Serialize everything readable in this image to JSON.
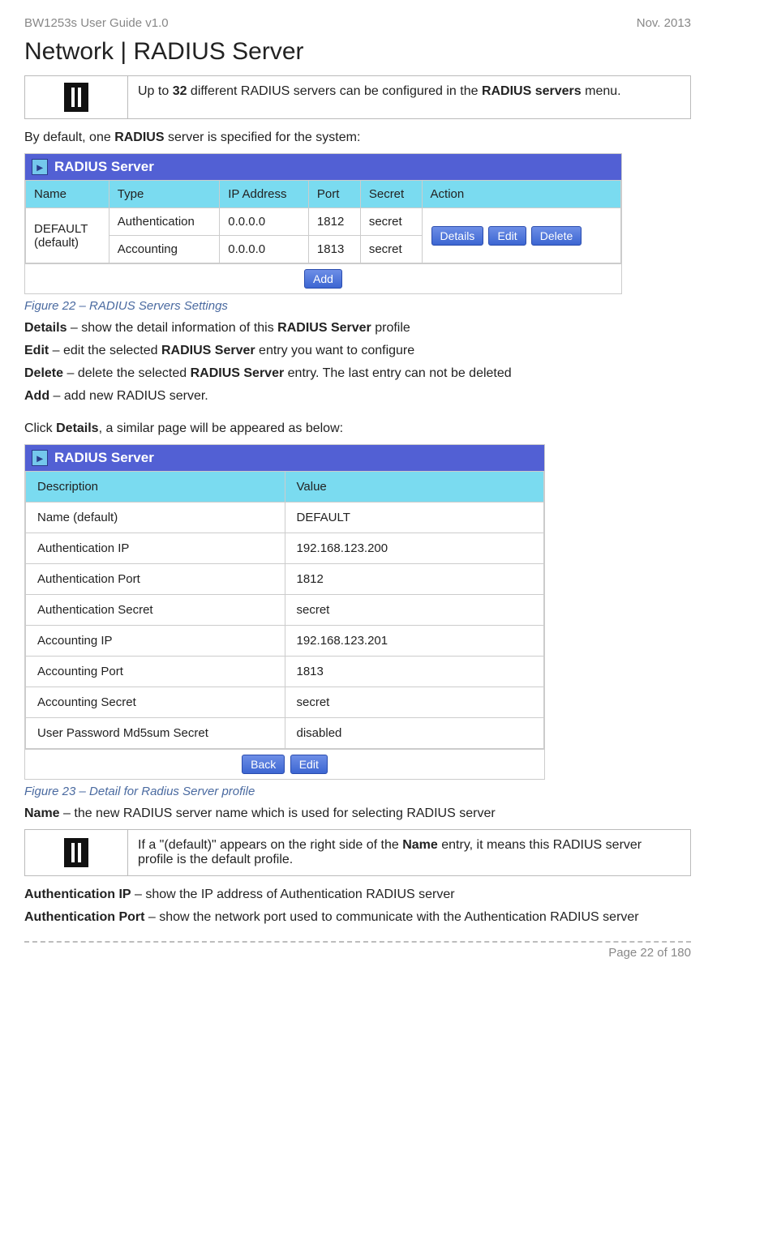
{
  "header": {
    "left": "BW1253s User Guide v1.0",
    "right": "Nov.  2013"
  },
  "titleLine": "Network | RADIUS Server",
  "infobox1": "Up to <b>32</b> different RADIUS servers can be configured in the <b>RADIUS servers</b> menu.",
  "intro1_before": "By default, one ",
  "intro1_bold": "RADIUS",
  "intro1_after": " server is specified for the system:",
  "table1": {
    "title": "RADIUS Server",
    "headers": [
      "Name",
      "Type",
      "IP Address",
      "Port",
      "Secret",
      "Action"
    ],
    "nameCell": "DEFAULT\n(default)",
    "rows": [
      {
        "type": "Authentication",
        "ip": "0.0.0.0",
        "port": "1812",
        "secret": "secret"
      },
      {
        "type": "Accounting",
        "ip": "0.0.0.0",
        "port": "1813",
        "secret": "secret"
      }
    ],
    "actionButtons": [
      "Details",
      "Edit",
      "Delete"
    ],
    "addLabel": "Add"
  },
  "fig22": "Figure 22 – RADIUS Servers Settings",
  "defs": [
    {
      "term": "Details",
      "desc_before": " – show the detail information of this ",
      "desc_bold": "RADIUS Server",
      "desc_after": " profile"
    },
    {
      "term": "Edit",
      "desc_before": " – edit the selected ",
      "desc_bold": "RADIUS Server",
      "desc_after": " entry you want to configure"
    },
    {
      "term": "Delete",
      "desc_before": " – delete the selected ",
      "desc_bold": "RADIUS Server",
      "desc_after": " entry. The last entry can not be deleted"
    },
    {
      "term": "Add",
      "desc_before": " – add new RADIUS server.",
      "desc_bold": "",
      "desc_after": ""
    }
  ],
  "intro2_before": "Click ",
  "intro2_bold": "Details",
  "intro2_after": ", a similar page will be appeared as below:",
  "table2": {
    "title": "RADIUS Server",
    "headers": [
      "Description",
      "Value"
    ],
    "rows": [
      [
        "Name  (default)",
        "DEFAULT"
      ],
      [
        "Authentication IP",
        "192.168.123.200"
      ],
      [
        "Authentication Port",
        "1812"
      ],
      [
        "Authentication Secret",
        "secret"
      ],
      [
        "Accounting IP",
        "192.168.123.201"
      ],
      [
        "Accounting Port",
        "1813"
      ],
      [
        "Accounting Secret",
        "secret"
      ],
      [
        "User Password Md5sum Secret",
        "disabled"
      ]
    ],
    "buttons": [
      "Back",
      "Edit"
    ]
  },
  "fig23": "Figure 23 – Detail for Radius Server profile",
  "name_term": "Name",
  "name_desc": " – the new RADIUS server name which is used for selecting RADIUS server",
  "infobox2": "If a \"(default)\" appears on the right side of the <b>Name</b> entry, it means this RADIUS server profile is the default profile.",
  "authIP_term": "Authentication IP",
  "authIP_desc": " – show the IP address of Authentication RADIUS server",
  "authPort_term": "Authentication Port",
  "authPort_desc": " – show the network port used to communicate with the Authentication RADIUS server",
  "footer": "Page 22 of 180"
}
